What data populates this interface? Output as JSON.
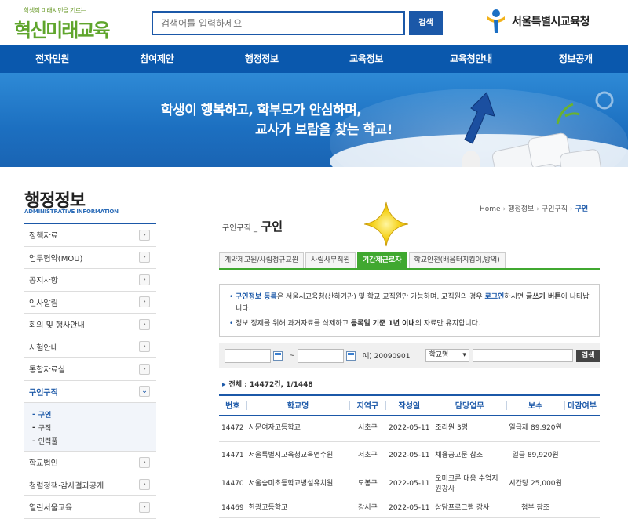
{
  "header": {
    "logo_tagline": "학생의 미래시민을 기르는",
    "logo_text": "혁신미래교육",
    "search_placeholder": "검색어를 입력하세요",
    "search_button": "검색",
    "org_name": "서울특별시교육청"
  },
  "nav": [
    "전자민원",
    "참여제안",
    "행정정보",
    "교육정보",
    "교육청안내",
    "정보공개"
  ],
  "banner": {
    "line1": "학생이 행복하고, 학부모가 안심하며,",
    "line2": "교사가 보람을 찾는 학교!"
  },
  "sidebar": {
    "title": "행정정보",
    "subtitle": "ADMINISTRATIVE INFORMATION",
    "items": [
      {
        "label": "정책자료"
      },
      {
        "label": "업무협약(MOU)"
      },
      {
        "label": "공지사항"
      },
      {
        "label": "인사알림"
      },
      {
        "label": "회의 및 행사안내"
      },
      {
        "label": "시험안내"
      },
      {
        "label": "통합자료실"
      },
      {
        "label": "구인구직"
      },
      {
        "label": "학교법인"
      },
      {
        "label": "청렴정책·감사결과공개"
      },
      {
        "label": "열린서울교육"
      }
    ],
    "subitems": [
      "구인",
      "구직",
      "인력풀"
    ]
  },
  "breadcrumb": {
    "home": "Home",
    "level1": "행정정보",
    "level2": "구인구직",
    "current": "구인"
  },
  "page_title": {
    "prefix": "구인구직 _",
    "main": "구인"
  },
  "tabs": [
    "계약제교원/사립정규교원",
    "사립사무직원",
    "기간제근로자",
    "학교안전(배움터지킴이,방역)"
  ],
  "notice": {
    "n1_hl1": "구인정보 등록",
    "n1_text1": "은 서울시교육청(산하기관) 및 학교 교직원만 가능하며, 교직원의 경우 ",
    "n1_hl2": "로그인",
    "n1_text2": "하시면 ",
    "n1_bold": "글쓰기 버튼",
    "n1_text3": "이 나타납니다.",
    "n2_text1": "정보 정제를 위해 과거자료를 삭제하고 ",
    "n2_bold": "등록일 기준 1년 이내",
    "n2_text2": "의 자료만 유지합니다."
  },
  "filter": {
    "tilde": "~",
    "example": "예) 20090901",
    "select_value": "학교명",
    "button": "검색"
  },
  "total": "전체 : 14472건, 1/1448",
  "table": {
    "headers": [
      "번호",
      "학교명",
      "지역구",
      "작성일",
      "담당업무",
      "보수",
      "마감여부"
    ],
    "rows": [
      [
        "14472",
        "서문여자고등학교",
        "서초구",
        "2022-05-11",
        "조리원 3명",
        "일급제 89,920원",
        ""
      ],
      [
        "14471",
        "서울특별시교육청교육연수원",
        "서초구",
        "2022-05-11",
        "채용공고문 참조",
        "일급 89,920원",
        ""
      ],
      [
        "14470",
        "서울숭미초등학교병설유치원",
        "도봉구",
        "2022-05-11",
        "오미크론 대응 수업지원강사",
        "시간당 25,000원",
        ""
      ],
      [
        "14469",
        "한광고등학교",
        "강서구",
        "2022-05-11",
        "상담프로그램 강사",
        "첨부 참조",
        ""
      ]
    ]
  },
  "colors": {
    "primary": "#1b58a8",
    "nav": "#0a58ad",
    "tab_active": "#40a830",
    "logo_green": "#5fa52c"
  }
}
